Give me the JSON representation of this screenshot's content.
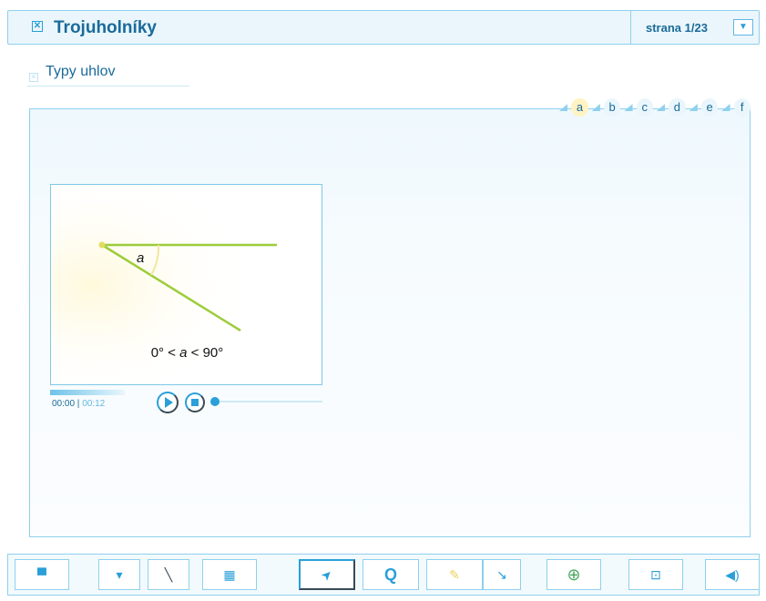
{
  "header": {
    "close_icon": "close-icon",
    "title": "Trojuholníky",
    "page_label": "strana 1/23",
    "page_dropdown_icon": "▼"
  },
  "section": {
    "icon": "close-icon",
    "title": "Typy uhlov"
  },
  "tabs": [
    "a",
    "b",
    "c",
    "d",
    "e",
    "f"
  ],
  "active_tab": "a",
  "animation": {
    "angle_label": "a",
    "formula_prefix": "0° < ",
    "formula_var": "a",
    "formula_suffix": " < 90°"
  },
  "player": {
    "current_time": "00:00",
    "total_time": "00:12",
    "separator": " | "
  },
  "toolbar": {
    "icons": [
      "board-icon",
      "dropdown-icon",
      "line-tool-icon",
      "calculator-icon",
      "pointer-icon",
      "magnifier-icon",
      "highlighter-icon",
      "pen-icon",
      "zoom-in-icon",
      "screen-icon",
      "speaker-icon"
    ],
    "glyphs": {
      "dropdown": "▾",
      "line": "╲",
      "calculator": "▦",
      "pointer": "➤",
      "magnifier": "Q",
      "highlighter": "✎",
      "pen": "↘",
      "zoom": "⊕",
      "screen": "⊡",
      "speaker": "◀)",
      "board": "▀"
    }
  },
  "colors": {
    "accent": "#2a9fd8",
    "text": "#1a6b9a",
    "border": "#8fd0ee",
    "angle_lines": "#9ccc3a"
  }
}
